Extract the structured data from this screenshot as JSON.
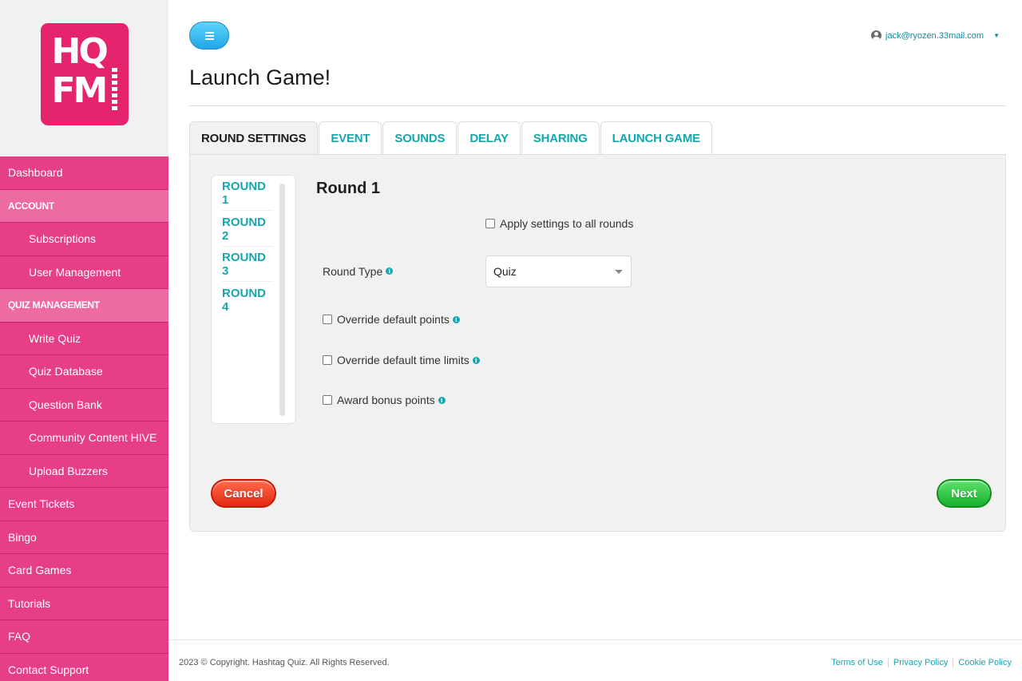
{
  "brand": {
    "logo_line1": "HQ",
    "logo_line2": "FM",
    "accent_color": "#e6246d",
    "nav_color": "#e63e87",
    "link_color": "#14a7b0"
  },
  "sidebar": {
    "items": [
      {
        "label": "Dashboard",
        "type": "top"
      },
      {
        "label": "ACCOUNT",
        "type": "section"
      },
      {
        "label": "Subscriptions",
        "type": "sub"
      },
      {
        "label": "User Management",
        "type": "sub"
      },
      {
        "label": "QUIZ MANAGEMENT",
        "type": "section"
      },
      {
        "label": "Write Quiz",
        "type": "sub"
      },
      {
        "label": "Quiz Database",
        "type": "sub"
      },
      {
        "label": "Question Bank",
        "type": "sub"
      },
      {
        "label": "Community Content HIVE",
        "type": "sub"
      },
      {
        "label": "Upload Buzzers",
        "type": "sub"
      },
      {
        "label": "Event Tickets",
        "type": "top"
      },
      {
        "label": "Bingo",
        "type": "top"
      },
      {
        "label": "Card Games",
        "type": "top"
      },
      {
        "label": "Tutorials",
        "type": "top"
      },
      {
        "label": "FAQ",
        "type": "top"
      },
      {
        "label": "Contact Support",
        "type": "top"
      }
    ]
  },
  "header": {
    "menu_icon": "hamburger-icon",
    "user_email": "jack@ryozen.33mail.com",
    "user_icon": "user-circle-icon",
    "page_title": "Launch Game!"
  },
  "tabs": [
    {
      "label": "ROUND SETTINGS",
      "active": true
    },
    {
      "label": "EVENT",
      "active": false
    },
    {
      "label": "SOUNDS",
      "active": false
    },
    {
      "label": "DELAY",
      "active": false
    },
    {
      "label": "SHARING",
      "active": false
    },
    {
      "label": "LAUNCH GAME",
      "active": false
    }
  ],
  "rounds": [
    "ROUND 1",
    "ROUND 2",
    "ROUND 3",
    "ROUND 4"
  ],
  "form": {
    "heading": "Round 1",
    "apply_all_label": "Apply settings to all rounds",
    "apply_all_checked": false,
    "round_type_label": "Round Type",
    "round_type_value": "Quiz",
    "override_points_label": "Override default points",
    "override_points_checked": false,
    "override_time_label": "Override default time limits",
    "override_time_checked": false,
    "bonus_label": "Award bonus points",
    "bonus_checked": false,
    "info_icon": "info-circle-icon"
  },
  "buttons": {
    "cancel_label": "Cancel",
    "next_label": "Next",
    "cancel_color": "#e42a10",
    "next_color": "#17b22b"
  },
  "footer": {
    "copyright": "2023 © Copyright. Hashtag Quiz. All Rights Reserved.",
    "links": [
      "Terms of Use",
      "Privacy Policy",
      "Cookie Policy"
    ]
  }
}
